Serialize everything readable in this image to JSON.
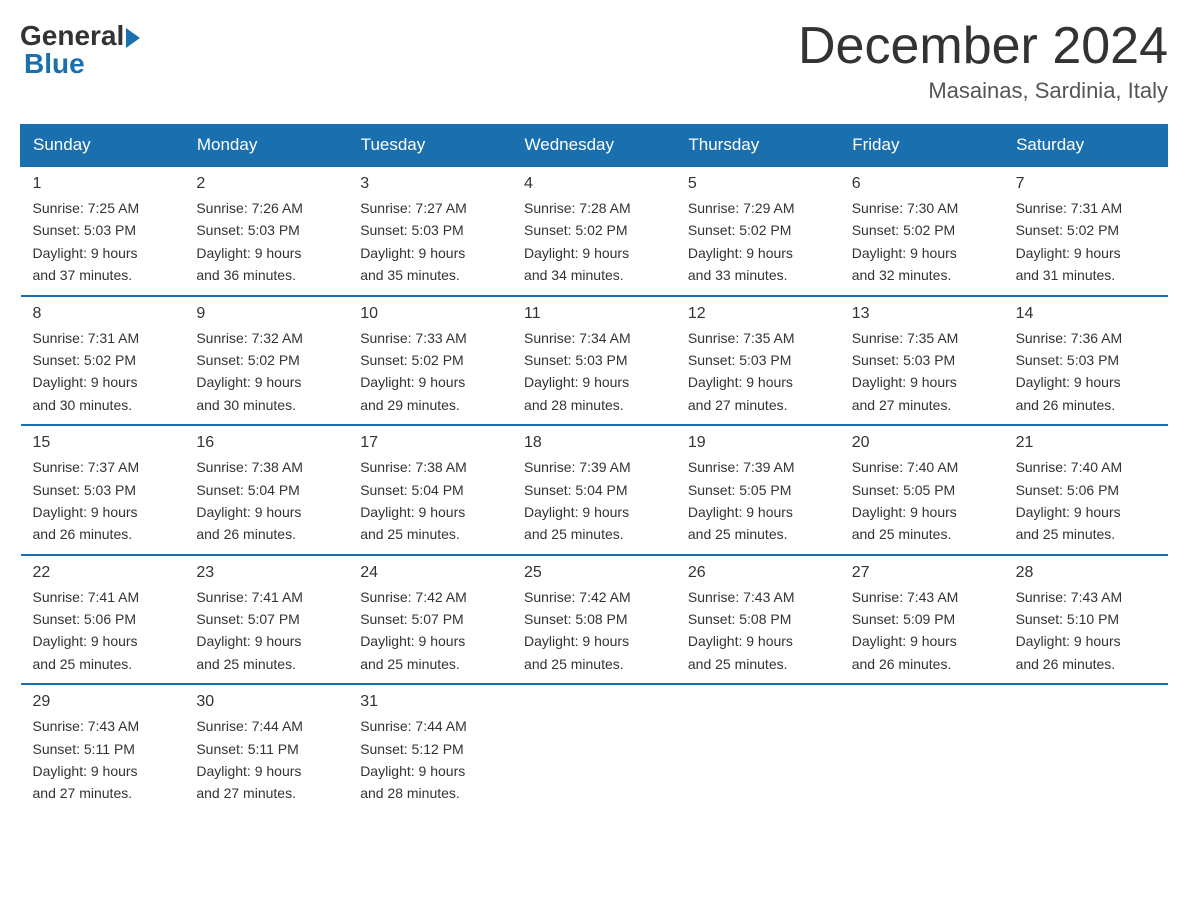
{
  "logo": {
    "general": "General",
    "blue": "Blue"
  },
  "title": "December 2024",
  "location": "Masainas, Sardinia, Italy",
  "days_of_week": [
    "Sunday",
    "Monday",
    "Tuesday",
    "Wednesday",
    "Thursday",
    "Friday",
    "Saturday"
  ],
  "weeks": [
    [
      {
        "num": "1",
        "sunrise": "Sunrise: 7:25 AM",
        "sunset": "Sunset: 5:03 PM",
        "daylight": "Daylight: 9 hours",
        "daylight2": "and 37 minutes."
      },
      {
        "num": "2",
        "sunrise": "Sunrise: 7:26 AM",
        "sunset": "Sunset: 5:03 PM",
        "daylight": "Daylight: 9 hours",
        "daylight2": "and 36 minutes."
      },
      {
        "num": "3",
        "sunrise": "Sunrise: 7:27 AM",
        "sunset": "Sunset: 5:03 PM",
        "daylight": "Daylight: 9 hours",
        "daylight2": "and 35 minutes."
      },
      {
        "num": "4",
        "sunrise": "Sunrise: 7:28 AM",
        "sunset": "Sunset: 5:02 PM",
        "daylight": "Daylight: 9 hours",
        "daylight2": "and 34 minutes."
      },
      {
        "num": "5",
        "sunrise": "Sunrise: 7:29 AM",
        "sunset": "Sunset: 5:02 PM",
        "daylight": "Daylight: 9 hours",
        "daylight2": "and 33 minutes."
      },
      {
        "num": "6",
        "sunrise": "Sunrise: 7:30 AM",
        "sunset": "Sunset: 5:02 PM",
        "daylight": "Daylight: 9 hours",
        "daylight2": "and 32 minutes."
      },
      {
        "num": "7",
        "sunrise": "Sunrise: 7:31 AM",
        "sunset": "Sunset: 5:02 PM",
        "daylight": "Daylight: 9 hours",
        "daylight2": "and 31 minutes."
      }
    ],
    [
      {
        "num": "8",
        "sunrise": "Sunrise: 7:31 AM",
        "sunset": "Sunset: 5:02 PM",
        "daylight": "Daylight: 9 hours",
        "daylight2": "and 30 minutes."
      },
      {
        "num": "9",
        "sunrise": "Sunrise: 7:32 AM",
        "sunset": "Sunset: 5:02 PM",
        "daylight": "Daylight: 9 hours",
        "daylight2": "and 30 minutes."
      },
      {
        "num": "10",
        "sunrise": "Sunrise: 7:33 AM",
        "sunset": "Sunset: 5:02 PM",
        "daylight": "Daylight: 9 hours",
        "daylight2": "and 29 minutes."
      },
      {
        "num": "11",
        "sunrise": "Sunrise: 7:34 AM",
        "sunset": "Sunset: 5:03 PM",
        "daylight": "Daylight: 9 hours",
        "daylight2": "and 28 minutes."
      },
      {
        "num": "12",
        "sunrise": "Sunrise: 7:35 AM",
        "sunset": "Sunset: 5:03 PM",
        "daylight": "Daylight: 9 hours",
        "daylight2": "and 27 minutes."
      },
      {
        "num": "13",
        "sunrise": "Sunrise: 7:35 AM",
        "sunset": "Sunset: 5:03 PM",
        "daylight": "Daylight: 9 hours",
        "daylight2": "and 27 minutes."
      },
      {
        "num": "14",
        "sunrise": "Sunrise: 7:36 AM",
        "sunset": "Sunset: 5:03 PM",
        "daylight": "Daylight: 9 hours",
        "daylight2": "and 26 minutes."
      }
    ],
    [
      {
        "num": "15",
        "sunrise": "Sunrise: 7:37 AM",
        "sunset": "Sunset: 5:03 PM",
        "daylight": "Daylight: 9 hours",
        "daylight2": "and 26 minutes."
      },
      {
        "num": "16",
        "sunrise": "Sunrise: 7:38 AM",
        "sunset": "Sunset: 5:04 PM",
        "daylight": "Daylight: 9 hours",
        "daylight2": "and 26 minutes."
      },
      {
        "num": "17",
        "sunrise": "Sunrise: 7:38 AM",
        "sunset": "Sunset: 5:04 PM",
        "daylight": "Daylight: 9 hours",
        "daylight2": "and 25 minutes."
      },
      {
        "num": "18",
        "sunrise": "Sunrise: 7:39 AM",
        "sunset": "Sunset: 5:04 PM",
        "daylight": "Daylight: 9 hours",
        "daylight2": "and 25 minutes."
      },
      {
        "num": "19",
        "sunrise": "Sunrise: 7:39 AM",
        "sunset": "Sunset: 5:05 PM",
        "daylight": "Daylight: 9 hours",
        "daylight2": "and 25 minutes."
      },
      {
        "num": "20",
        "sunrise": "Sunrise: 7:40 AM",
        "sunset": "Sunset: 5:05 PM",
        "daylight": "Daylight: 9 hours",
        "daylight2": "and 25 minutes."
      },
      {
        "num": "21",
        "sunrise": "Sunrise: 7:40 AM",
        "sunset": "Sunset: 5:06 PM",
        "daylight": "Daylight: 9 hours",
        "daylight2": "and 25 minutes."
      }
    ],
    [
      {
        "num": "22",
        "sunrise": "Sunrise: 7:41 AM",
        "sunset": "Sunset: 5:06 PM",
        "daylight": "Daylight: 9 hours",
        "daylight2": "and 25 minutes."
      },
      {
        "num": "23",
        "sunrise": "Sunrise: 7:41 AM",
        "sunset": "Sunset: 5:07 PM",
        "daylight": "Daylight: 9 hours",
        "daylight2": "and 25 minutes."
      },
      {
        "num": "24",
        "sunrise": "Sunrise: 7:42 AM",
        "sunset": "Sunset: 5:07 PM",
        "daylight": "Daylight: 9 hours",
        "daylight2": "and 25 minutes."
      },
      {
        "num": "25",
        "sunrise": "Sunrise: 7:42 AM",
        "sunset": "Sunset: 5:08 PM",
        "daylight": "Daylight: 9 hours",
        "daylight2": "and 25 minutes."
      },
      {
        "num": "26",
        "sunrise": "Sunrise: 7:43 AM",
        "sunset": "Sunset: 5:08 PM",
        "daylight": "Daylight: 9 hours",
        "daylight2": "and 25 minutes."
      },
      {
        "num": "27",
        "sunrise": "Sunrise: 7:43 AM",
        "sunset": "Sunset: 5:09 PM",
        "daylight": "Daylight: 9 hours",
        "daylight2": "and 26 minutes."
      },
      {
        "num": "28",
        "sunrise": "Sunrise: 7:43 AM",
        "sunset": "Sunset: 5:10 PM",
        "daylight": "Daylight: 9 hours",
        "daylight2": "and 26 minutes."
      }
    ],
    [
      {
        "num": "29",
        "sunrise": "Sunrise: 7:43 AM",
        "sunset": "Sunset: 5:11 PM",
        "daylight": "Daylight: 9 hours",
        "daylight2": "and 27 minutes."
      },
      {
        "num": "30",
        "sunrise": "Sunrise: 7:44 AM",
        "sunset": "Sunset: 5:11 PM",
        "daylight": "Daylight: 9 hours",
        "daylight2": "and 27 minutes."
      },
      {
        "num": "31",
        "sunrise": "Sunrise: 7:44 AM",
        "sunset": "Sunset: 5:12 PM",
        "daylight": "Daylight: 9 hours",
        "daylight2": "and 28 minutes."
      },
      null,
      null,
      null,
      null
    ]
  ]
}
